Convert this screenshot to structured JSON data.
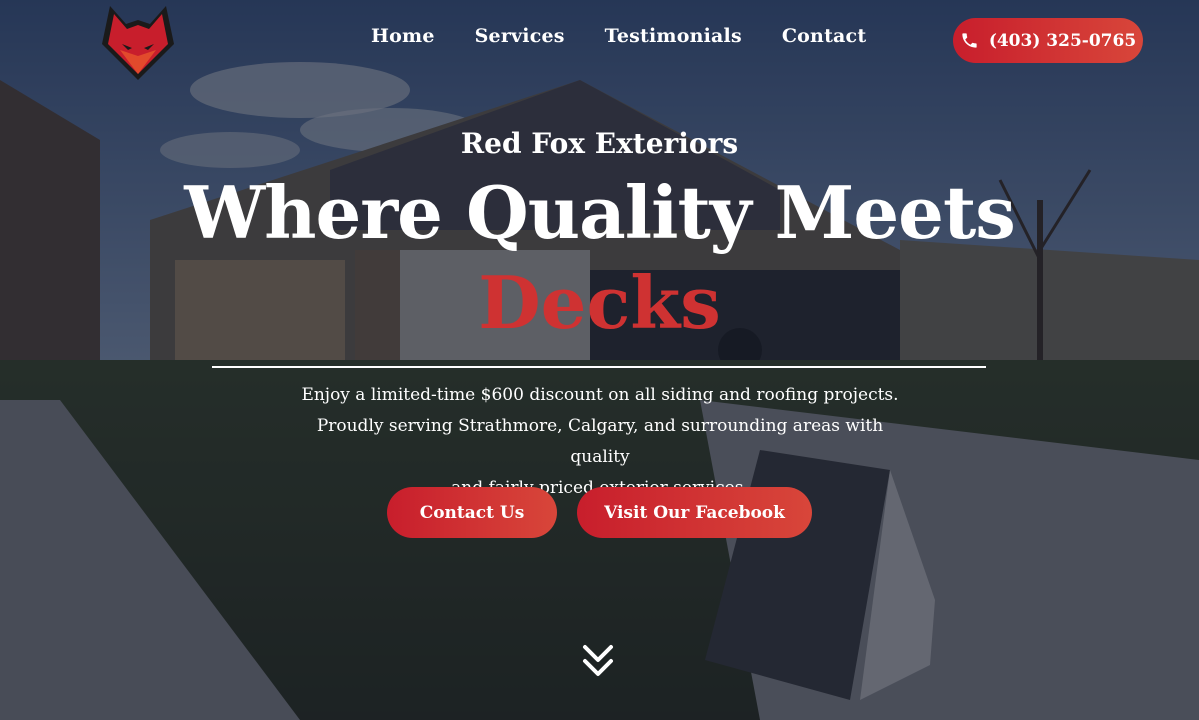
{
  "logo": {
    "icon": "fox-logo-icon",
    "color": "#c81e2c"
  },
  "nav": {
    "items": [
      "Home",
      "Services",
      "Testimonials",
      "Contact"
    ]
  },
  "phone": {
    "icon": "phone-icon",
    "label": "(403) 325-0765"
  },
  "hero": {
    "brand": "Red Fox Exteriors",
    "headline": "Where Quality Meets",
    "accent": "Decks",
    "description_lines": [
      "Enjoy a limited-time $600 discount on all siding and roofing projects.",
      "Proudly serving Strathmore, Calgary, and surrounding areas with quality",
      "and fairly priced exterior services."
    ],
    "buttons": {
      "contact": "Contact Us",
      "facebook": "Visit Our Facebook"
    },
    "scroll_icon": "double-chevron-down-icon"
  },
  "colors": {
    "accent_red": "#cf3232",
    "button_gradient_start": "#c81e2c",
    "button_gradient_end": "#d8463a"
  }
}
